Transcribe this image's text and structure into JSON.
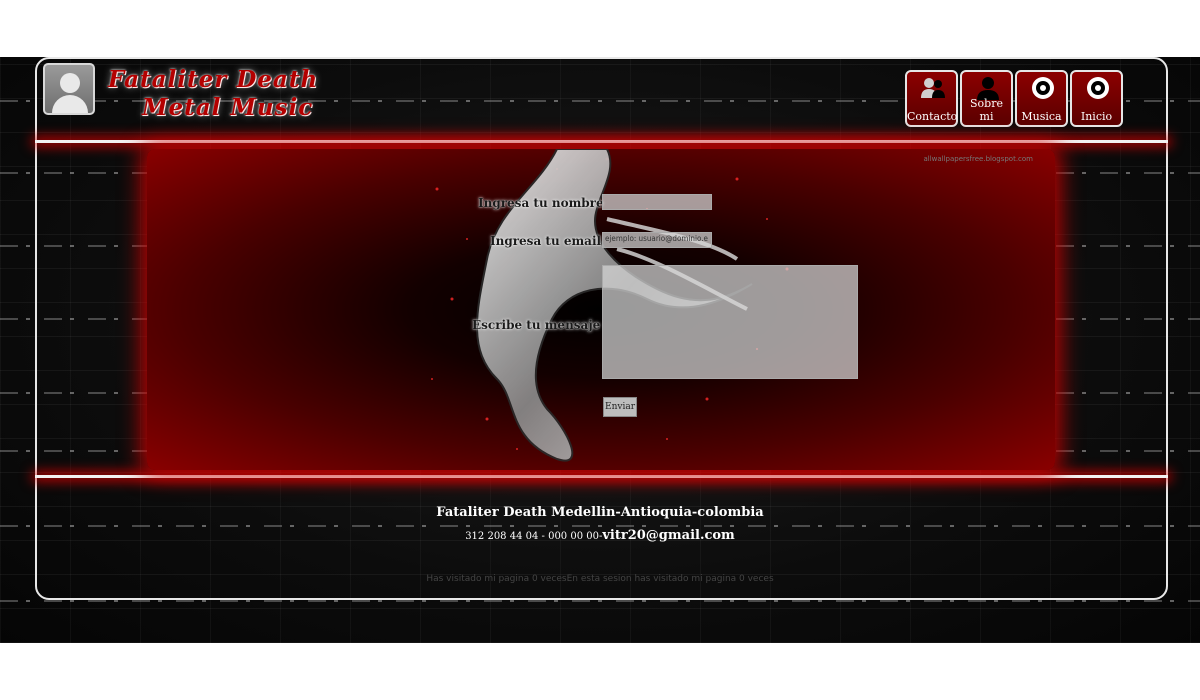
{
  "header": {
    "title_line1": "Fataliter Death",
    "title_line2": "Metal Music"
  },
  "nav": {
    "items": [
      {
        "label": "Contacto",
        "icon": "users-icon"
      },
      {
        "label": "Sobre mi",
        "icon": "user-icon"
      },
      {
        "label": "Musica",
        "icon": "target-icon"
      },
      {
        "label": "Inicio",
        "icon": "target-icon"
      }
    ]
  },
  "banner": {
    "watermark": "allwallpapersfree.blogspot.com"
  },
  "form": {
    "name_label": "Ingresa tu nombre",
    "email_label": "Ingresa tu email",
    "email_placeholder": "ejemplo: usuario@dominio.e",
    "message_label": "Escribe tu mensaje",
    "send_label": "Enviar"
  },
  "footer": {
    "main": "Fataliter Death Medellin-Antioquia-colombia",
    "phones": "312 208 44 04 - 000 00 00-",
    "email": "vitr20@gmail.com",
    "visits": "Has visitado mi pagina 0 vecesEn esta sesion has visitado mi pagina 0 veces"
  },
  "colors": {
    "accent": "#b40000",
    "glow": "#e60000"
  }
}
